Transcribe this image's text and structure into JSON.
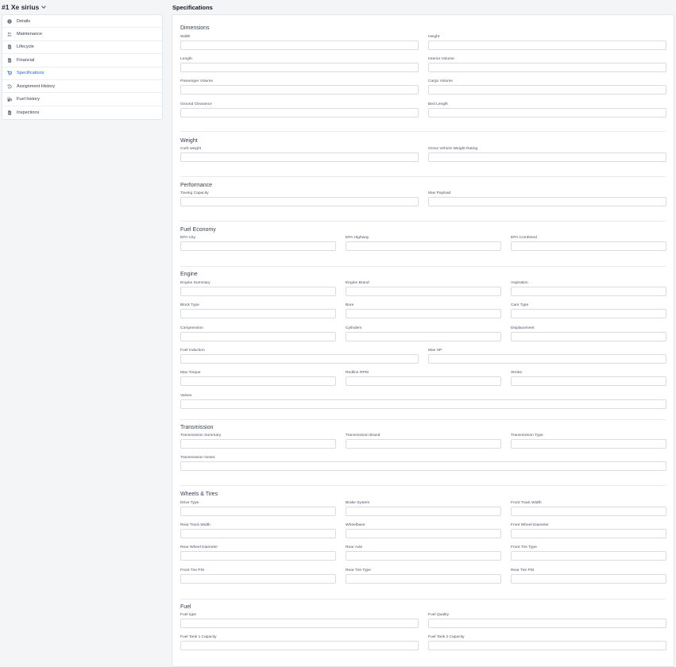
{
  "vehicle": {
    "name": "#1 Xe sirius"
  },
  "sidebar": {
    "items": [
      {
        "label": "Details",
        "icon": "info-circle-icon",
        "active": false
      },
      {
        "label": "Maintenance",
        "icon": "users-icon",
        "active": false
      },
      {
        "label": "Lifecycle",
        "icon": "document-icon",
        "active": false
      },
      {
        "label": "Financial",
        "icon": "document-icon",
        "active": false
      },
      {
        "label": "Specifications",
        "icon": "cart-icon",
        "active": true
      },
      {
        "label": "Assignment History",
        "icon": "history-icon",
        "active": false
      },
      {
        "label": "Fuel history",
        "icon": "fuel-pump-icon",
        "active": false
      },
      {
        "label": "Inspections",
        "icon": "document-icon",
        "active": false
      }
    ]
  },
  "page": {
    "title": "Specifications"
  },
  "colors": {
    "accent": "#2563eb",
    "border": "#d9dce1"
  },
  "sections": [
    {
      "title": "Dimensions",
      "fields": [
        "Width",
        "Height",
        "Length",
        "Interior Volume",
        "Passenger Volume",
        "Cargo Volume",
        "Ground Clearance",
        "Bed Length"
      ]
    },
    {
      "title": "Weight",
      "fields": [
        "Curb weight",
        "Gross Vehicle Weight Rating"
      ]
    },
    {
      "title": "Performance",
      "fields": [
        "Towing Capacity",
        "Max Payload"
      ]
    },
    {
      "title": "Fuel Economy",
      "fields": [
        "EPA City",
        "EPA Highway",
        "EPA Combined"
      ]
    },
    {
      "title": "Engine",
      "fields": [
        "Engine Summary",
        "Engine Brand",
        "Aspiration",
        "Block Type",
        "Bore",
        "Cam Type",
        "Compression",
        "Cylinders",
        "Displacement",
        "Fuel Induction",
        "Max HP",
        "Max Torque",
        "Redline RPM",
        "Stroke",
        "Valves"
      ]
    },
    {
      "title": "Transmission",
      "fields": [
        "Transmission Summary",
        "Transmission Brand",
        "Transmission Type",
        "Transmission Gears"
      ]
    },
    {
      "title": "Wheels & Tires",
      "fields": [
        "Drive Type",
        "Brake System",
        "Front Track Width",
        "Rear Track Width",
        "Wheelbase",
        "Front Wheel Diameter",
        "Rear Wheel Diameter",
        "Rear Axle",
        "Front Tire Type",
        "Front Tire PSI",
        "Rear Tire Type",
        "Rear Tire PSI"
      ]
    },
    {
      "title": "Fuel",
      "fields": [
        "Fuel type",
        "Fuel Quality",
        "Fuel Tank 1 Capacity",
        "Fuel Tank 2 Capacity"
      ]
    }
  ]
}
